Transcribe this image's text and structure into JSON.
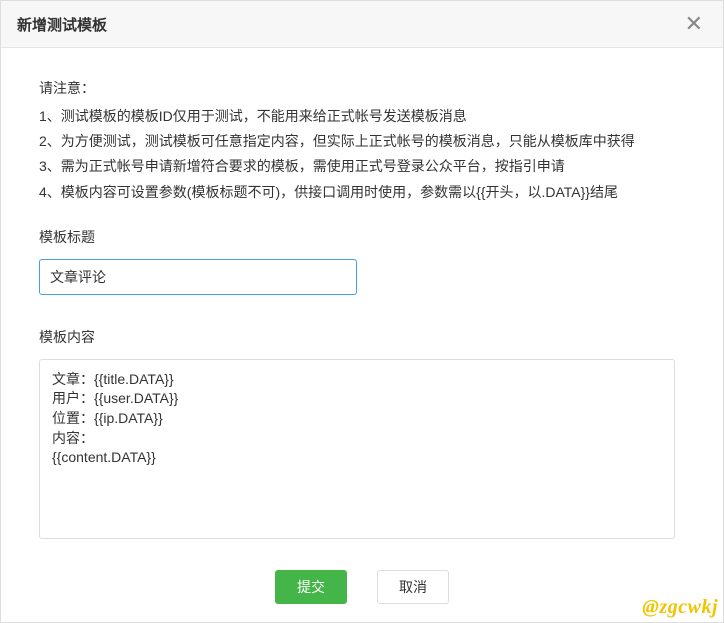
{
  "header": {
    "title": "新增测试模板"
  },
  "notice": {
    "title": "请注意：",
    "items": [
      "1、测试模板的模板ID仅用于测试，不能用来给正式帐号发送模板消息",
      "2、为方便测试，测试模板可任意指定内容，但实际上正式帐号的模板消息，只能从模板库中获得",
      "3、需为正式帐号申请新增符合要求的模板，需使用正式号登录公众平台，按指引申请",
      "4、模板内容可设置参数(模板标题不可)，供接口调用时使用，参数需以{{开头，以.DATA}}结尾"
    ]
  },
  "fields": {
    "title_label": "模板标题",
    "title_value": "文章评论",
    "content_label": "模板内容",
    "content_value": "文章：{{title.DATA}}\n用户：{{user.DATA}}\n位置：{{ip.DATA}}\n内容：\n{{content.DATA}}"
  },
  "footer": {
    "submit_label": "提交",
    "cancel_label": "取消"
  },
  "watermark": "@zgcwkj"
}
